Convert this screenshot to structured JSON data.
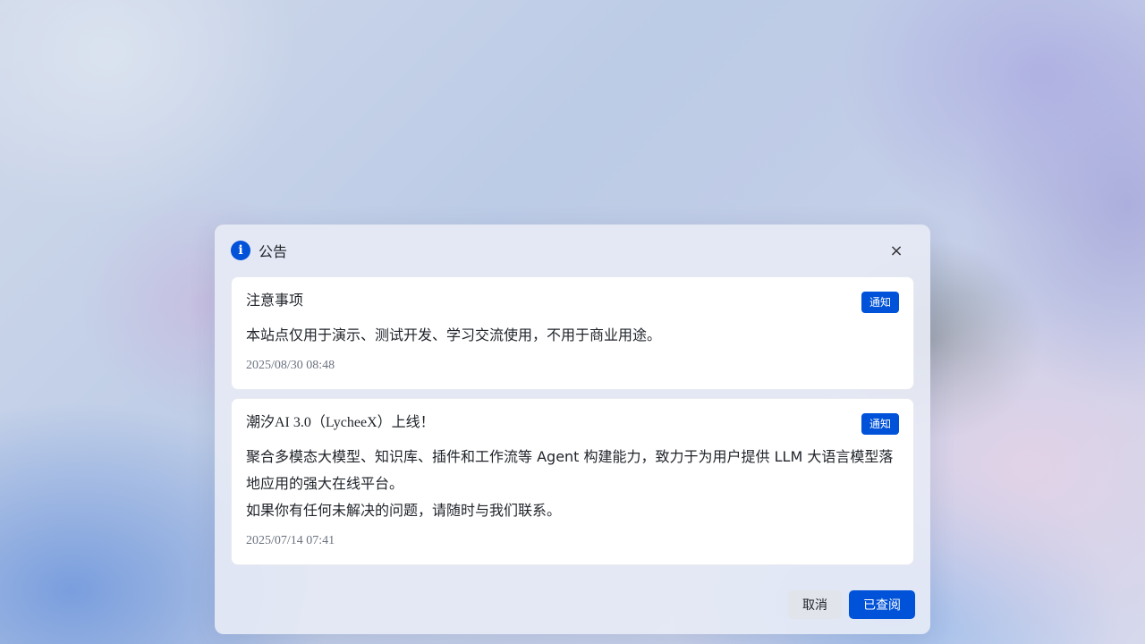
{
  "dialog": {
    "title": "公告",
    "icon": "info-icon",
    "close_icon": "×",
    "accent_color": "#0052d9"
  },
  "announcements": [
    {
      "title": "注意事项",
      "badge": "通知",
      "body": [
        "本站点仅用于演示、测试开发、学习交流使用，不用于商业用途。"
      ],
      "date": "2025/08/30 08:48"
    },
    {
      "title": "潮汐AI 3.0（LycheeX）上线！",
      "badge": "通知",
      "body": [
        "聚合多模态大模型、知识库、插件和工作流等 Agent 构建能力，致力于为用户提供 LLM 大语言模型落地应用的强大在线平台。",
        "如果你有任何未解决的问题，请随时与我们联系。"
      ],
      "date": "2025/07/14 07:41"
    }
  ],
  "footer": {
    "cancel_label": "取消",
    "confirm_label": "已查阅"
  }
}
